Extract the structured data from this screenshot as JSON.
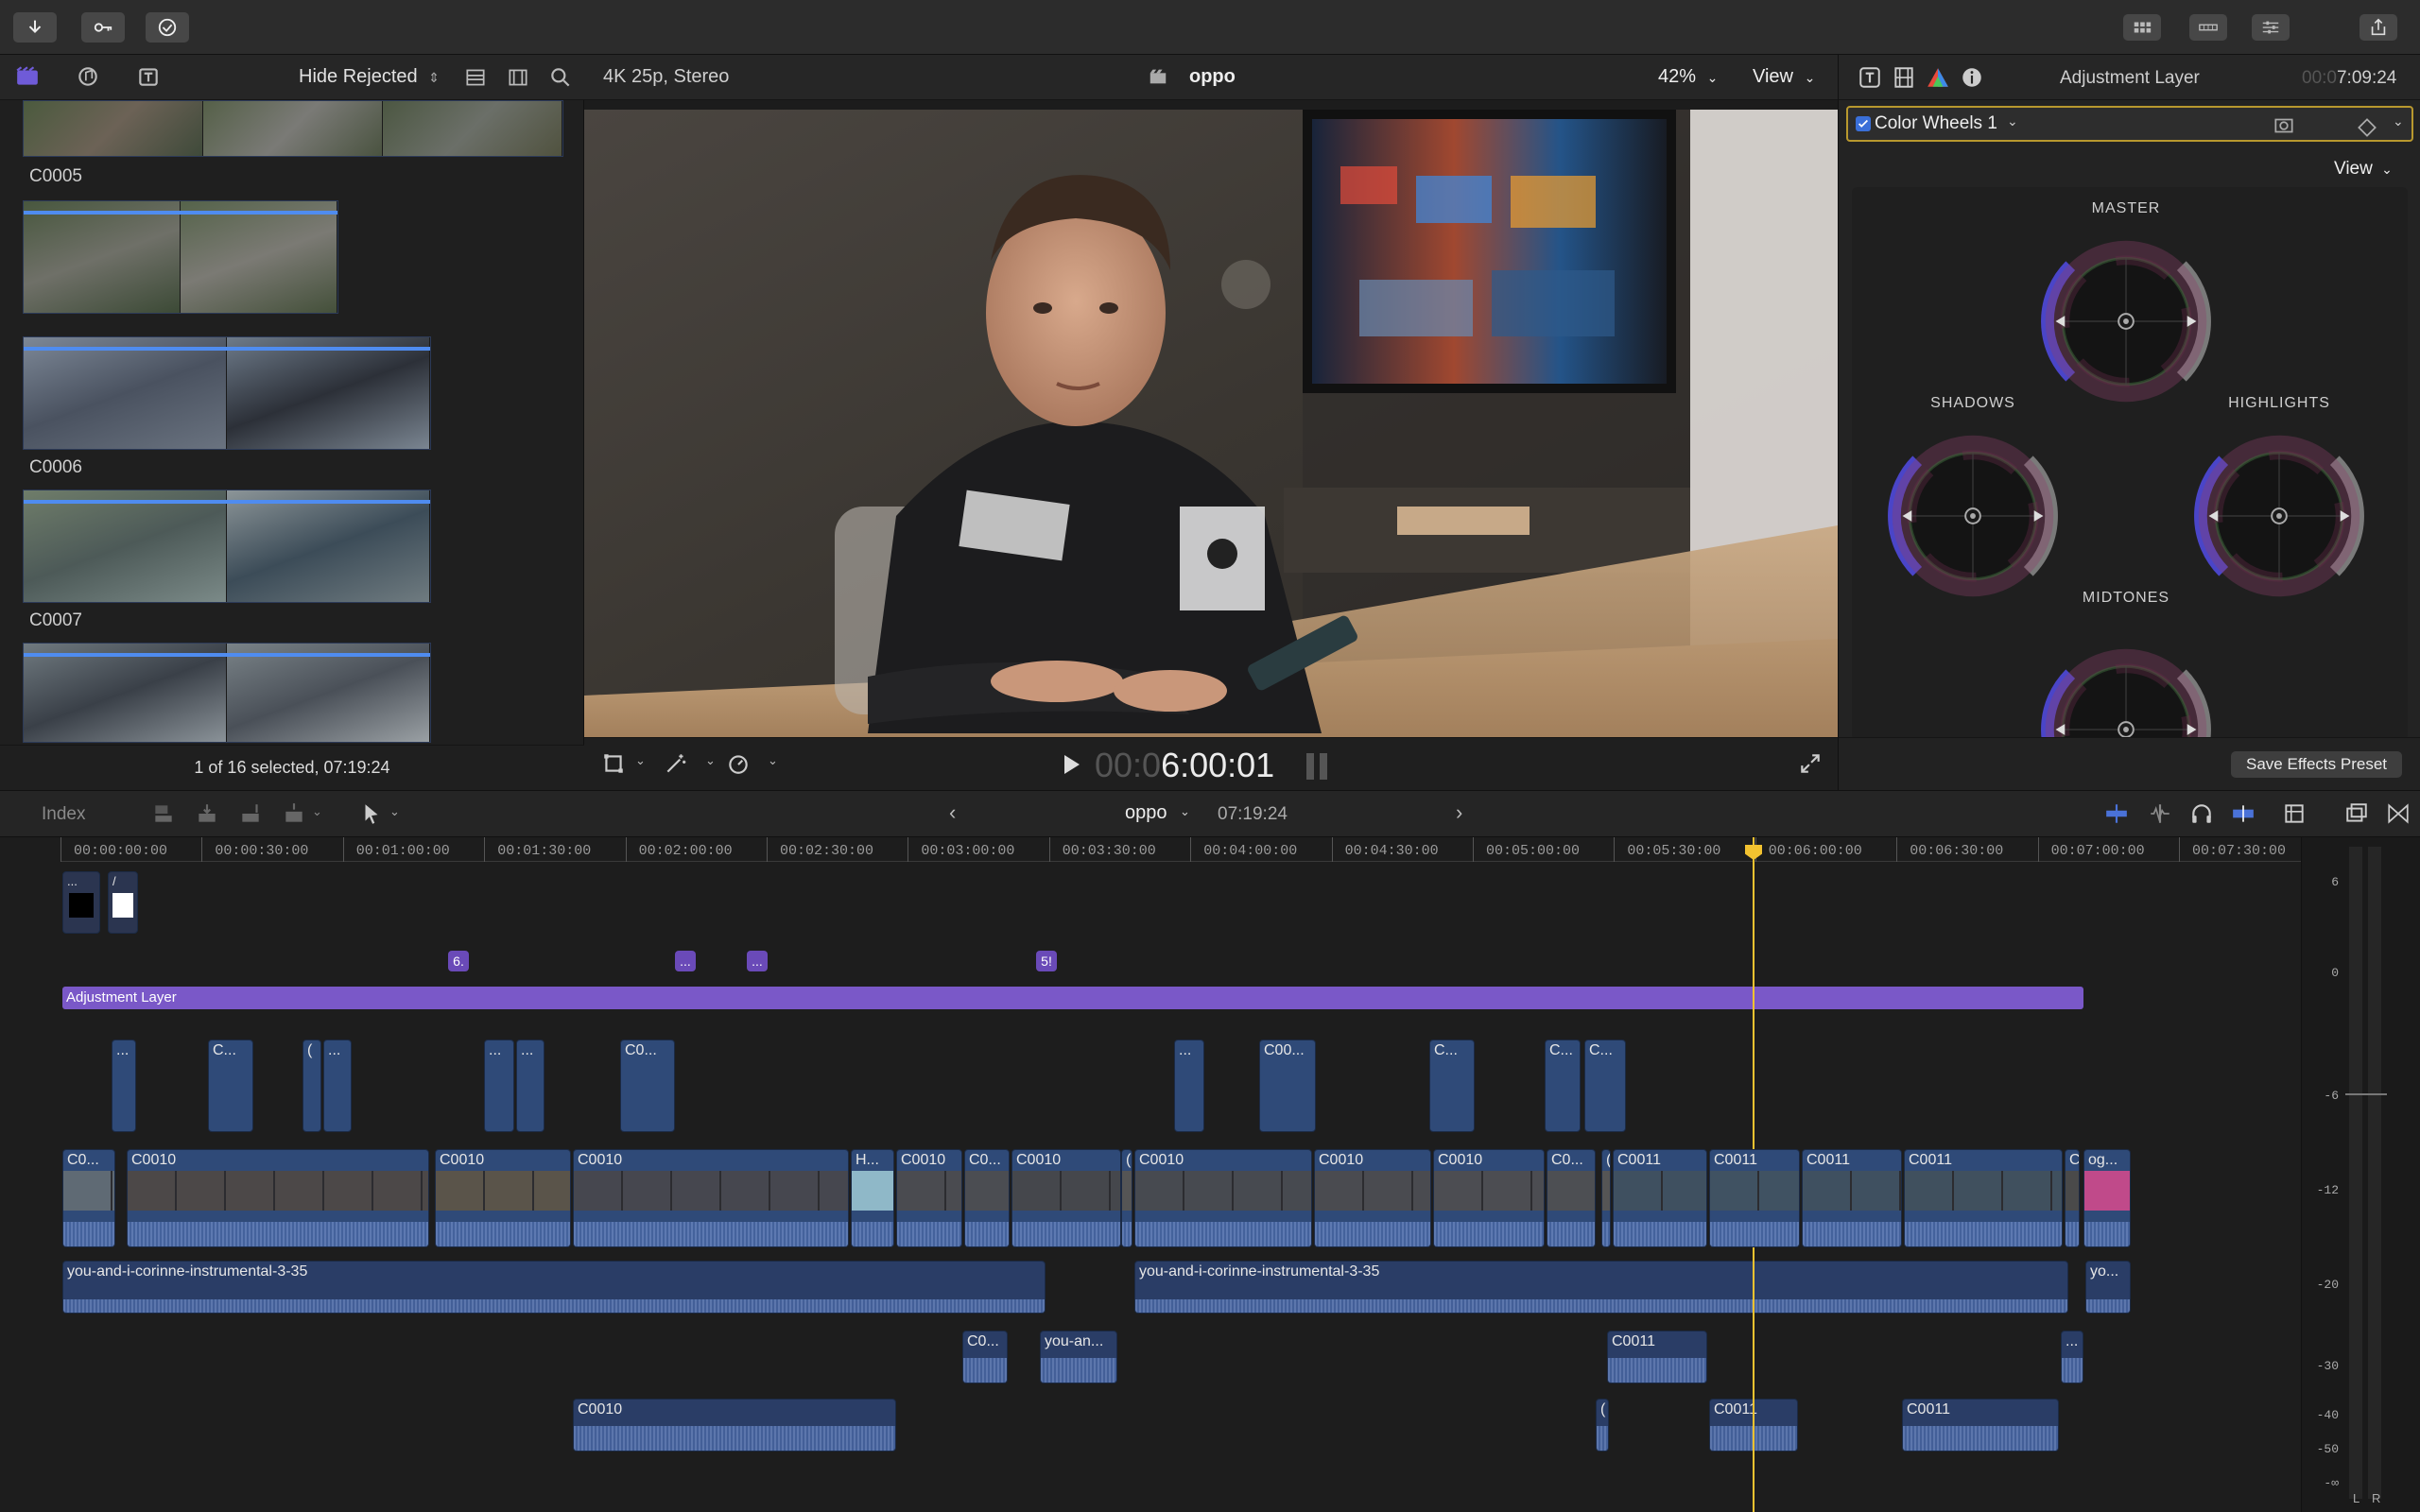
{
  "browser": {
    "filter_label": "Hide Rejected",
    "clips": [
      "C0005",
      "C0006",
      "C0007"
    ],
    "status": "1 of 16 selected, 07:19:24"
  },
  "viewer": {
    "format": "4K 25p, Stereo",
    "project": "oppo",
    "zoom": "42%",
    "view_label": "View",
    "timecode_dim": "00:0",
    "timecode": "6:00:01"
  },
  "inspector": {
    "title": "Adjustment Layer",
    "duration_dim": "00:0",
    "duration": "7:09:24",
    "effect_name": "Color Wheels 1",
    "view_label": "View",
    "wheels": {
      "master": "MASTER",
      "shadows": "SHADOWS",
      "highlights": "HIGHLIGHTS",
      "midtones": "MIDTONES"
    },
    "save_preset": "Save Effects Preset"
  },
  "timeline_toolbar": {
    "index_label": "Index",
    "project": "oppo",
    "duration": "07:19:24"
  },
  "timeline": {
    "ruler": [
      "00:00:00:00",
      "00:00:30:00",
      "00:01:00:00",
      "00:01:30:00",
      "00:02:00:00",
      "00:02:30:00",
      "00:03:00:00",
      "00:03:30:00",
      "00:04:00:00",
      "00:04:30:00",
      "00:05:00:00",
      "00:05:30:00",
      "00:06:00:00",
      "00:06:30:00",
      "00:07:00:00",
      "00:07:30:00"
    ],
    "adjustment_layer": "Adjustment Layer",
    "markers": [
      "6.",
      "...",
      "...",
      "5!"
    ],
    "title_clips": [
      "...",
      "/"
    ],
    "connected_clips": [
      "...",
      "C...",
      "(",
      "...",
      "...",
      "...",
      "C0...",
      "...",
      "C00...",
      "C...",
      "C...",
      "C..."
    ],
    "primary_clips": [
      "C0...",
      "C0010",
      "C0010",
      "C0010",
      "H...",
      "C0010",
      "C0...",
      "C0010",
      "(",
      "C0010",
      "C0010",
      "C0010",
      "C0...",
      "(",
      "C0011",
      "C0011",
      "C0011",
      "C0011",
      "C",
      "og..."
    ],
    "music_1": "you-and-i-corinne-instrumental-3-35",
    "music_2": "you-and-i-corinne-instrumental-3-35",
    "music_3": "yo...",
    "audio_clips": [
      "C0...",
      "you-an...",
      "C0011",
      "..."
    ],
    "audio_clips_2": [
      "C0010",
      "(",
      "C0011",
      "C0011"
    ],
    "meter_scale": [
      "6",
      "0",
      "-6",
      "-12",
      "-20",
      "-30",
      "-40",
      "-50",
      "-∞"
    ],
    "meter_channels": [
      "L",
      "R"
    ]
  },
  "colors": {
    "accent": "#f2c230",
    "clip_blue": "#2f4a78",
    "adjustment": "#6a4ab8",
    "selection": "#b8982e"
  }
}
